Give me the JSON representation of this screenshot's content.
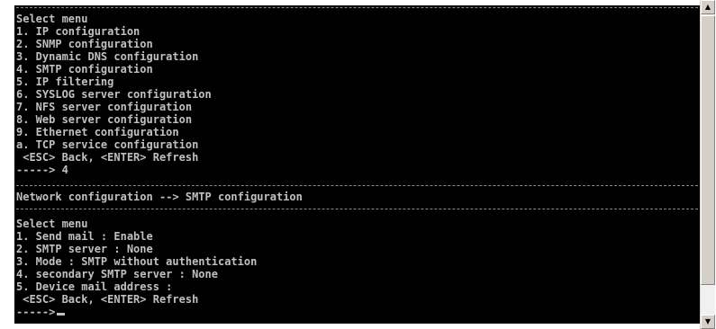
{
  "top_menu": {
    "title": "Select menu",
    "items": [
      "1. IP configuration",
      "2. SNMP configuration",
      "3. Dynamic DNS configuration",
      "4. SMTP configuration",
      "5. IP filtering",
      "6. SYSLOG server configuration",
      "7. NFS server configuration",
      "8. Web server configuration",
      "9. Ethernet configuration",
      "a. TCP service configuration"
    ],
    "hint": " <ESC> Back, <ENTER> Refresh",
    "prompt": "-----> 4"
  },
  "breadcrumb": "Network configuration --> SMTP configuration",
  "smtp_menu": {
    "title": "Select menu",
    "items": [
      "1. Send mail : Enable",
      "2. SMTP server : None",
      "3. Mode : SMTP without authentication",
      "4. secondary SMTP server : None",
      "5. Device mail address :"
    ],
    "hint": " <ESC> Back, <ENTER> Refresh",
    "prompt": "----->"
  },
  "scrollbar": {
    "up_icon": "arrow-up-icon",
    "down_icon": "arrow-down-icon"
  }
}
